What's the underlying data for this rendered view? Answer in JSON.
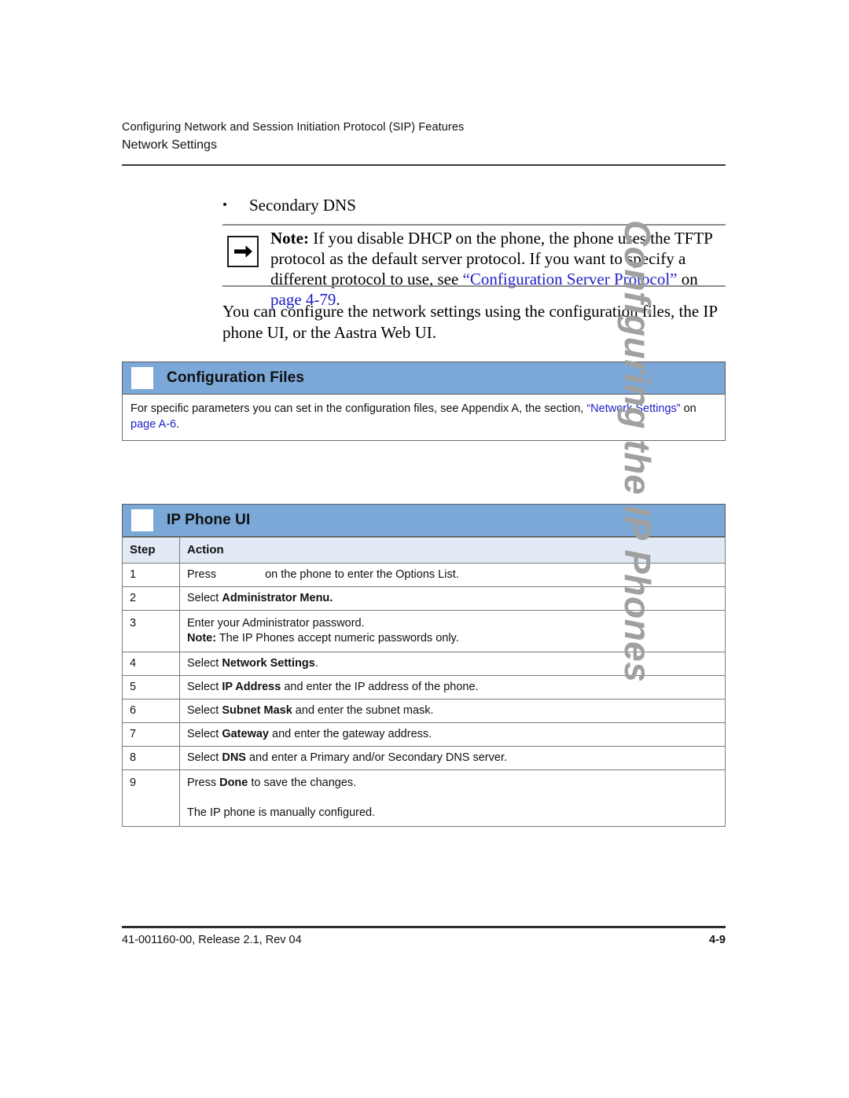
{
  "header": {
    "chapter_title": "Configuring Network and Session Initiation Protocol (SIP) Features",
    "section_title": "Network Settings"
  },
  "bullet": {
    "marker": "•",
    "text": "Secondary DNS"
  },
  "note": {
    "icon": "arrow-right-icon",
    "label": "Note:",
    "text_1": " If you disable DHCP on the phone, the phone uses the TFTP protocol as the default server protocol. If you want to specify a different protocol to use, see ",
    "xref_1": "“Configuration Server Protocol”",
    "text_2": " on ",
    "xref_2": "page 4-79",
    "text_3": "."
  },
  "intro_paragraph": "You can configure the network settings using the configuration files, the IP phone UI, or the Aastra Web UI.",
  "config_files_section": {
    "title": "Configuration Files",
    "body_text_1": "For specific parameters you can set in the configuration files, see Appendix A, the section, ",
    "body_xref_1": "“Network Settings”",
    "body_text_2": " on ",
    "body_xref_2": "page A-6",
    "body_text_3": "."
  },
  "ip_phone_ui_section": {
    "title": "IP Phone UI",
    "table": {
      "columns": [
        "Step",
        "Action"
      ],
      "rows": [
        {
          "step": "1",
          "action_pre": "Press",
          "action_post": "on the phone to enter the Options List.",
          "has_key_graphic_gap": true
        },
        {
          "step": "2",
          "action_plain": "Select ",
          "action_bold": "Administrator Menu.",
          "action_tail": ""
        },
        {
          "step": "3",
          "action_line1": "Enter your Administrator password.",
          "note_label": "Note:",
          "note_text": " The IP Phones accept numeric passwords only."
        },
        {
          "step": "4",
          "action_plain": "Select ",
          "action_bold": "Network Settings",
          "action_tail": "."
        },
        {
          "step": "5",
          "action_plain": "Select ",
          "action_bold": "IP Address",
          "action_tail": " and enter the IP address of the phone."
        },
        {
          "step": "6",
          "action_plain": "Select ",
          "action_bold": "Subnet Mask",
          "action_tail": " and enter the subnet mask."
        },
        {
          "step": "7",
          "action_plain": "Select ",
          "action_bold": "Gateway",
          "action_tail": " and enter the gateway address."
        },
        {
          "step": "8",
          "action_plain": "Select ",
          "action_bold": "DNS",
          "action_tail": " and enter a Primary and/or Secondary DNS server."
        },
        {
          "step": "9",
          "action_plain": "Press ",
          "action_bold": "Done",
          "action_tail": " to save the changes.",
          "extra_line": "The IP phone is manually configured."
        }
      ]
    }
  },
  "side_tab": {
    "text": "Configuring the IP Phones"
  },
  "footer": {
    "left": "41-001160-00, Release 2.1, Rev 04",
    "right": "4-9"
  },
  "colors": {
    "section_bar_blue": "#7CA8D8",
    "table_header_blue": "#E2EAF5",
    "xref_blue": "#2020C8",
    "side_tab_gray": "#A0A0A0"
  }
}
